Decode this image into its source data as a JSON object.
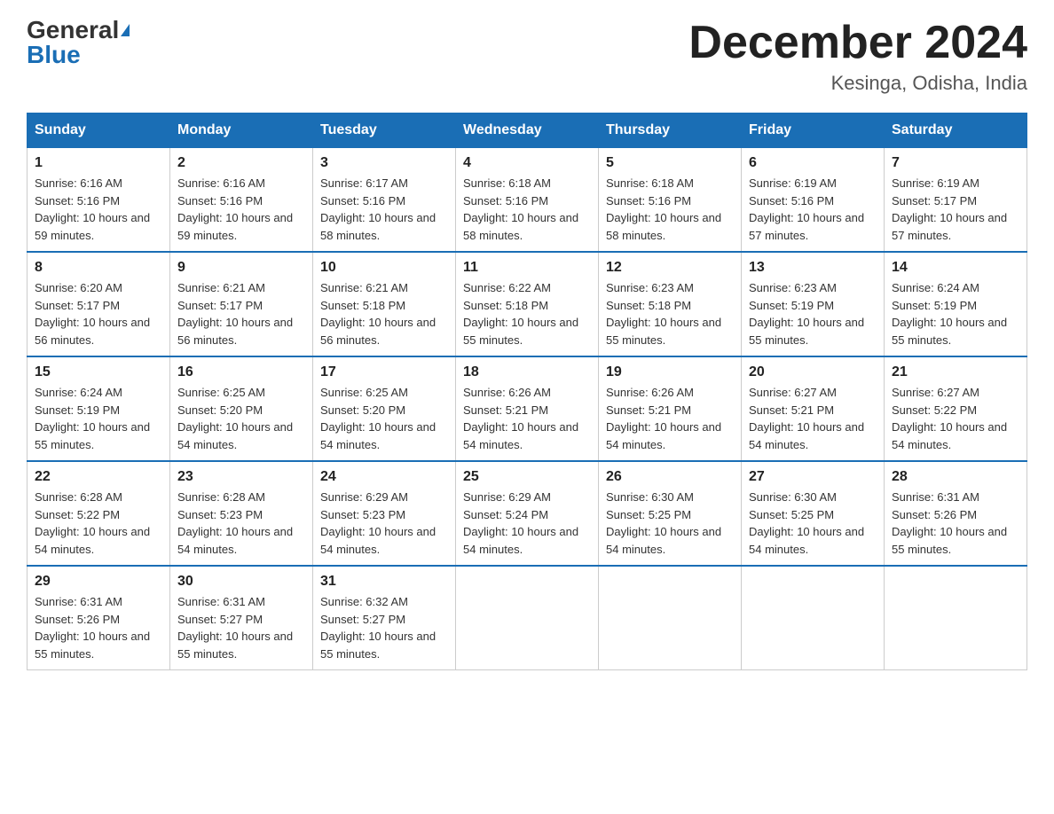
{
  "header": {
    "logo_general": "General",
    "logo_blue": "Blue",
    "month_title": "December 2024",
    "location": "Kesinga, Odisha, India"
  },
  "days_of_week": [
    "Sunday",
    "Monday",
    "Tuesday",
    "Wednesday",
    "Thursday",
    "Friday",
    "Saturday"
  ],
  "weeks": [
    [
      {
        "day": 1,
        "sunrise": "6:16 AM",
        "sunset": "5:16 PM",
        "daylight": "10 hours and 59 minutes."
      },
      {
        "day": 2,
        "sunrise": "6:16 AM",
        "sunset": "5:16 PM",
        "daylight": "10 hours and 59 minutes."
      },
      {
        "day": 3,
        "sunrise": "6:17 AM",
        "sunset": "5:16 PM",
        "daylight": "10 hours and 58 minutes."
      },
      {
        "day": 4,
        "sunrise": "6:18 AM",
        "sunset": "5:16 PM",
        "daylight": "10 hours and 58 minutes."
      },
      {
        "day": 5,
        "sunrise": "6:18 AM",
        "sunset": "5:16 PM",
        "daylight": "10 hours and 58 minutes."
      },
      {
        "day": 6,
        "sunrise": "6:19 AM",
        "sunset": "5:16 PM",
        "daylight": "10 hours and 57 minutes."
      },
      {
        "day": 7,
        "sunrise": "6:19 AM",
        "sunset": "5:17 PM",
        "daylight": "10 hours and 57 minutes."
      }
    ],
    [
      {
        "day": 8,
        "sunrise": "6:20 AM",
        "sunset": "5:17 PM",
        "daylight": "10 hours and 56 minutes."
      },
      {
        "day": 9,
        "sunrise": "6:21 AM",
        "sunset": "5:17 PM",
        "daylight": "10 hours and 56 minutes."
      },
      {
        "day": 10,
        "sunrise": "6:21 AM",
        "sunset": "5:18 PM",
        "daylight": "10 hours and 56 minutes."
      },
      {
        "day": 11,
        "sunrise": "6:22 AM",
        "sunset": "5:18 PM",
        "daylight": "10 hours and 55 minutes."
      },
      {
        "day": 12,
        "sunrise": "6:23 AM",
        "sunset": "5:18 PM",
        "daylight": "10 hours and 55 minutes."
      },
      {
        "day": 13,
        "sunrise": "6:23 AM",
        "sunset": "5:19 PM",
        "daylight": "10 hours and 55 minutes."
      },
      {
        "day": 14,
        "sunrise": "6:24 AM",
        "sunset": "5:19 PM",
        "daylight": "10 hours and 55 minutes."
      }
    ],
    [
      {
        "day": 15,
        "sunrise": "6:24 AM",
        "sunset": "5:19 PM",
        "daylight": "10 hours and 55 minutes."
      },
      {
        "day": 16,
        "sunrise": "6:25 AM",
        "sunset": "5:20 PM",
        "daylight": "10 hours and 54 minutes."
      },
      {
        "day": 17,
        "sunrise": "6:25 AM",
        "sunset": "5:20 PM",
        "daylight": "10 hours and 54 minutes."
      },
      {
        "day": 18,
        "sunrise": "6:26 AM",
        "sunset": "5:21 PM",
        "daylight": "10 hours and 54 minutes."
      },
      {
        "day": 19,
        "sunrise": "6:26 AM",
        "sunset": "5:21 PM",
        "daylight": "10 hours and 54 minutes."
      },
      {
        "day": 20,
        "sunrise": "6:27 AM",
        "sunset": "5:21 PM",
        "daylight": "10 hours and 54 minutes."
      },
      {
        "day": 21,
        "sunrise": "6:27 AM",
        "sunset": "5:22 PM",
        "daylight": "10 hours and 54 minutes."
      }
    ],
    [
      {
        "day": 22,
        "sunrise": "6:28 AM",
        "sunset": "5:22 PM",
        "daylight": "10 hours and 54 minutes."
      },
      {
        "day": 23,
        "sunrise": "6:28 AM",
        "sunset": "5:23 PM",
        "daylight": "10 hours and 54 minutes."
      },
      {
        "day": 24,
        "sunrise": "6:29 AM",
        "sunset": "5:23 PM",
        "daylight": "10 hours and 54 minutes."
      },
      {
        "day": 25,
        "sunrise": "6:29 AM",
        "sunset": "5:24 PM",
        "daylight": "10 hours and 54 minutes."
      },
      {
        "day": 26,
        "sunrise": "6:30 AM",
        "sunset": "5:25 PM",
        "daylight": "10 hours and 54 minutes."
      },
      {
        "day": 27,
        "sunrise": "6:30 AM",
        "sunset": "5:25 PM",
        "daylight": "10 hours and 54 minutes."
      },
      {
        "day": 28,
        "sunrise": "6:31 AM",
        "sunset": "5:26 PM",
        "daylight": "10 hours and 55 minutes."
      }
    ],
    [
      {
        "day": 29,
        "sunrise": "6:31 AM",
        "sunset": "5:26 PM",
        "daylight": "10 hours and 55 minutes."
      },
      {
        "day": 30,
        "sunrise": "6:31 AM",
        "sunset": "5:27 PM",
        "daylight": "10 hours and 55 minutes."
      },
      {
        "day": 31,
        "sunrise": "6:32 AM",
        "sunset": "5:27 PM",
        "daylight": "10 hours and 55 minutes."
      },
      null,
      null,
      null,
      null
    ]
  ]
}
